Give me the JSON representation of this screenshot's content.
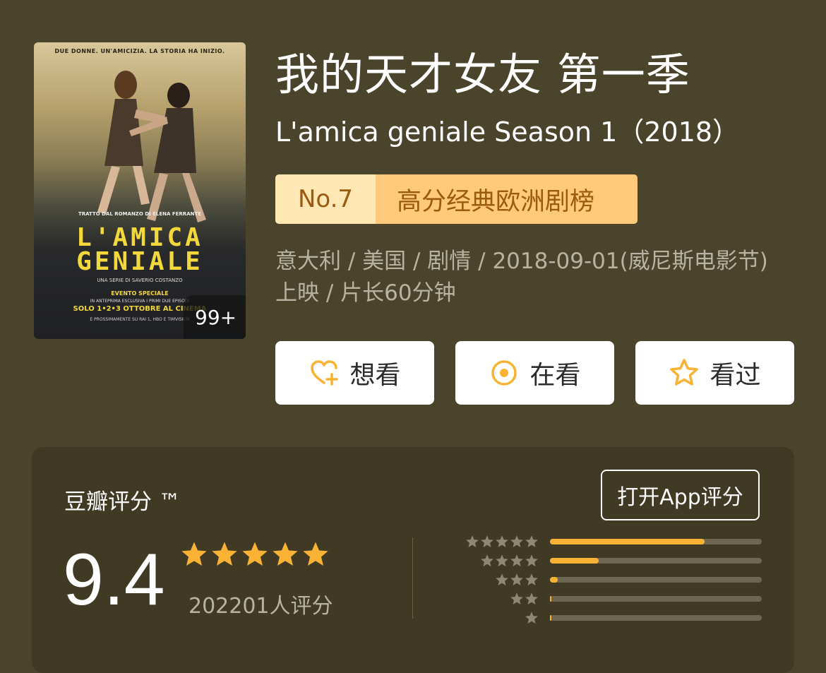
{
  "poster": {
    "tagline": "DUE DONNE. UN'AMICIZIA. LA STORIA HA INIZIO.",
    "subtitle": "TRATTO DAL ROMANZO DI ELENA FERRANTE",
    "title_line1": "L'AMICA",
    "title_line2": "GENIALE",
    "credit": "UNA SERIE DI SAVERIO COSTANZO",
    "event": "EVENTO SPECIALE",
    "anteprima": "IN ANTEPRIMA ESCLUSIVA I PRIMI DUE EPISODI",
    "dates": "SOLO 1•2•3 OTTOBRE AL CINEMA",
    "prox": "E PROSSIMAMENTE SU RAI 1, HBO E TIMVISION",
    "badge": "99+"
  },
  "title_cn": "我的天才女友 第一季",
  "title_en": "L'amica geniale Season 1（2018）",
  "rank": {
    "number": "No.7",
    "list": "高分经典欧洲剧榜",
    "colors": {
      "bg_left": "#ffe7b3",
      "bg_right": "#ffc97c",
      "text": "#9a5a10"
    }
  },
  "meta": "意大利 / 美国 / 剧情 / 2018-09-01(威尼斯电影节)上映 / 片长60分钟",
  "actions": [
    {
      "label": "想看",
      "icon": "heart-plus-icon"
    },
    {
      "label": "在看",
      "icon": "target-icon"
    },
    {
      "label": "看过",
      "icon": "star-outline-icon"
    }
  ],
  "rating": {
    "label": "豆瓣评分 ™",
    "open_app": "打开App评分",
    "score": "9.4",
    "stars": 5,
    "count": "202201人评分",
    "accent": "#f9b233",
    "distribution": [
      {
        "stars": 5,
        "fraction": 0.73
      },
      {
        "stars": 4,
        "fraction": 0.23
      },
      {
        "stars": 3,
        "fraction": 0.035
      },
      {
        "stars": 2,
        "fraction": 0.005
      },
      {
        "stars": 1,
        "fraction": 0.005
      }
    ]
  }
}
